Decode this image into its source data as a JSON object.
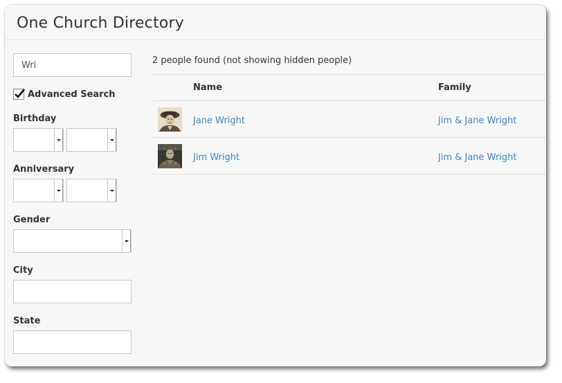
{
  "header": {
    "title": "One Church Directory"
  },
  "search": {
    "value": "Wri"
  },
  "advanced": {
    "label": "Advanced Search",
    "checked": true
  },
  "fields": {
    "birthday": "Birthday",
    "anniversary": "Anniversary",
    "gender": "Gender",
    "city": "City",
    "state": "State"
  },
  "results": {
    "summary": "2 people found (not showing hidden people)",
    "columns": {
      "photo": "",
      "name": "Name",
      "family": "Family"
    },
    "rows": [
      {
        "name": "Jane Wright",
        "family": "Jim & Jane Wright",
        "photo_icon": "woman-portrait-photo"
      },
      {
        "name": "Jim Wright",
        "family": "Jim & Jane Wright",
        "photo_icon": "soldier-portrait-photo"
      }
    ]
  }
}
